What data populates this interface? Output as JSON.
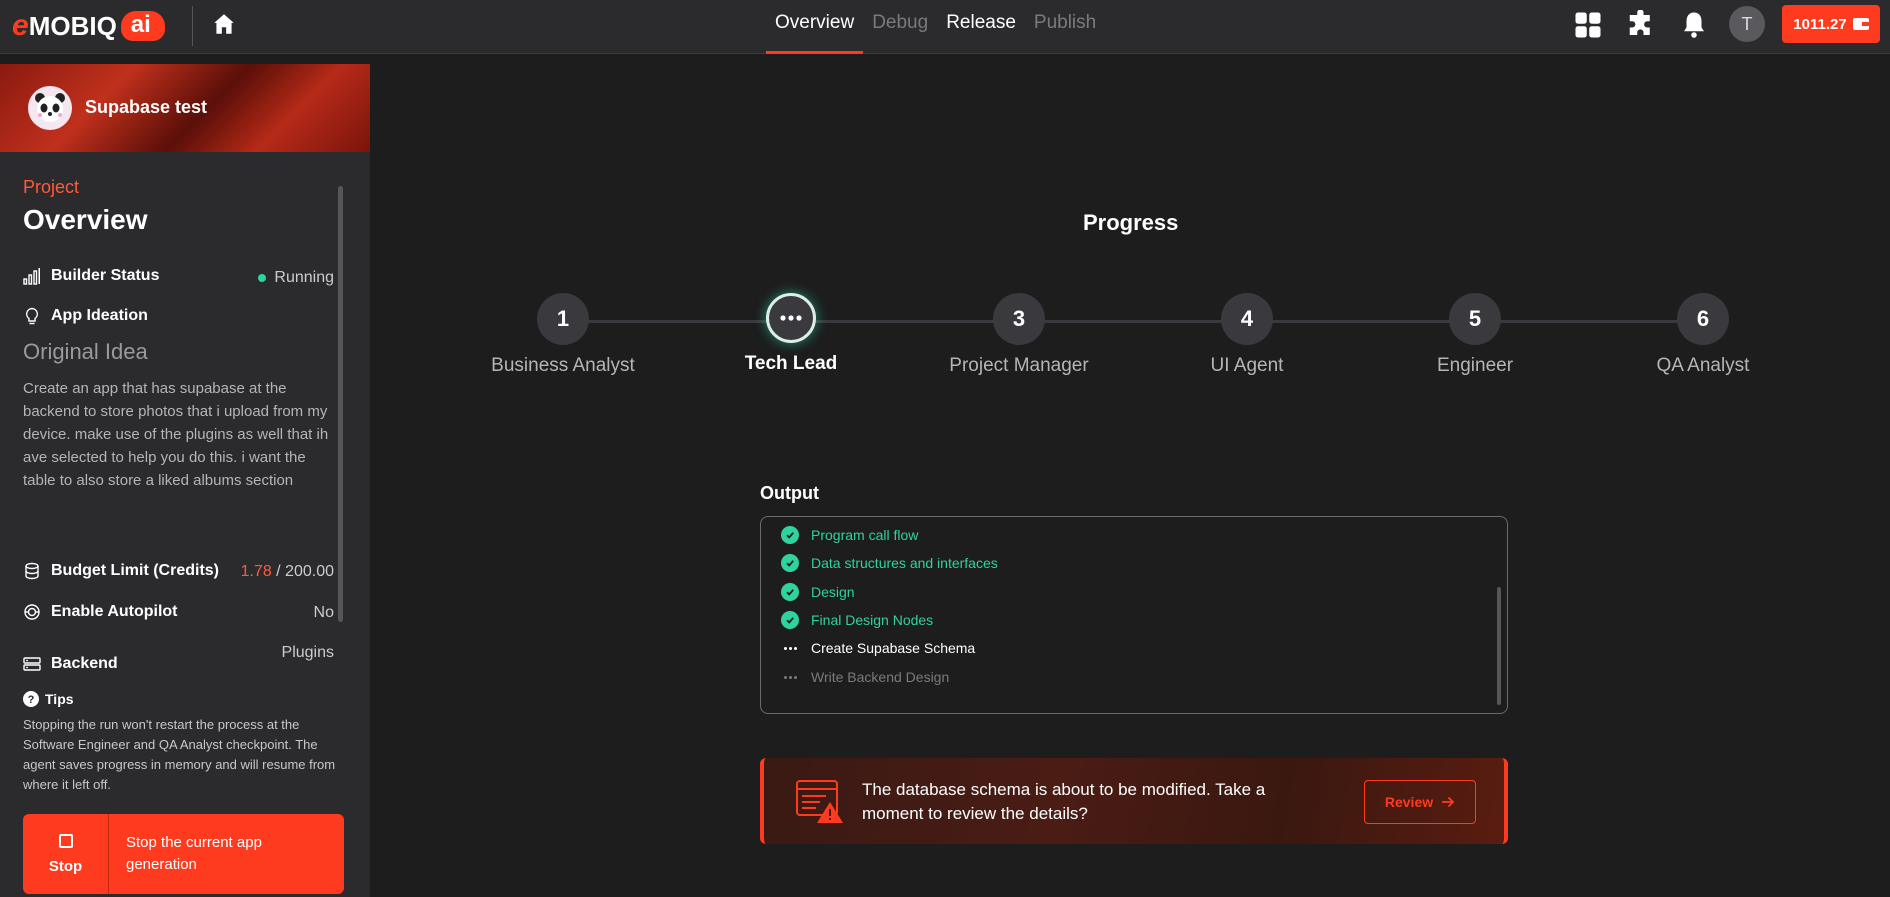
{
  "header": {
    "logo_text": "MOBIQ",
    "logo_e": "e",
    "logo_ai": "ai",
    "nav": [
      {
        "label": "Overview"
      },
      {
        "label": "Debug"
      },
      {
        "label": "Release"
      },
      {
        "label": "Publish"
      }
    ],
    "user_initial": "T",
    "credits": "1011.27"
  },
  "sidebar": {
    "project_name": "Supabase test",
    "section_label": "Project",
    "section_title": "Overview",
    "builder_status_label": "Builder Status",
    "builder_status_value": "Running",
    "app_ideation_label": "App Ideation",
    "original_idea_label": "Original Idea",
    "original_idea_text": "Create an app that has supabase at the backend to store photos that i upload from my device. make use of the plugins as well that ih ave selected to help you do this. i want the table to also store a liked albums section",
    "budget_label": "Budget Limit (Credits)",
    "budget_used": "1.78",
    "budget_total": " / 200.00",
    "autopilot_label": "Enable Autopilot",
    "autopilot_value": "No",
    "backend_label": "Backend",
    "backend_value": "Plugins",
    "tips_label": "Tips",
    "tips_text": "Stopping the run won't restart the process at the Software Engineer and QA Analyst checkpoint. The agent saves progress in memory and will resume from where it left off.",
    "stop_label": "Stop",
    "stop_desc": "Stop the current app generation"
  },
  "main": {
    "progress_title": "Progress",
    "steps": [
      {
        "number": "1",
        "label": "Business Analyst"
      },
      {
        "number": "",
        "label": "Tech Lead"
      },
      {
        "number": "3",
        "label": "Project Manager"
      },
      {
        "number": "4",
        "label": "UI Agent"
      },
      {
        "number": "5",
        "label": "Engineer"
      },
      {
        "number": "6",
        "label": "QA Analyst"
      }
    ],
    "output_title": "Output",
    "output_items": [
      {
        "label": "Program call flow",
        "state": "done"
      },
      {
        "label": "Data structures and interfaces",
        "state": "done"
      },
      {
        "label": "Design",
        "state": "done"
      },
      {
        "label": "Final Design Nodes",
        "state": "done"
      },
      {
        "label": "Create Supabase Schema",
        "state": "current"
      },
      {
        "label": "Write Backend Design",
        "state": "pending"
      }
    ],
    "alert_text": "The database schema is about to be modified. Take a moment to review the details?",
    "review_label": "Review"
  },
  "colors": {
    "accent": "#ff3b1f",
    "success": "#2fd39e",
    "background": "#1d1d1e",
    "panel": "#2b2b2d"
  },
  "icons": [
    "home-icon",
    "apps-grid-icon",
    "puzzle-icon",
    "bell-icon",
    "wallet-icon",
    "chart-bars-icon",
    "lightbulb-icon",
    "coins-icon",
    "autopilot-icon",
    "server-icon",
    "question-icon",
    "stop-icon",
    "check-icon",
    "ellipsis-icon",
    "database-warning-icon",
    "arrow-right-icon"
  ]
}
